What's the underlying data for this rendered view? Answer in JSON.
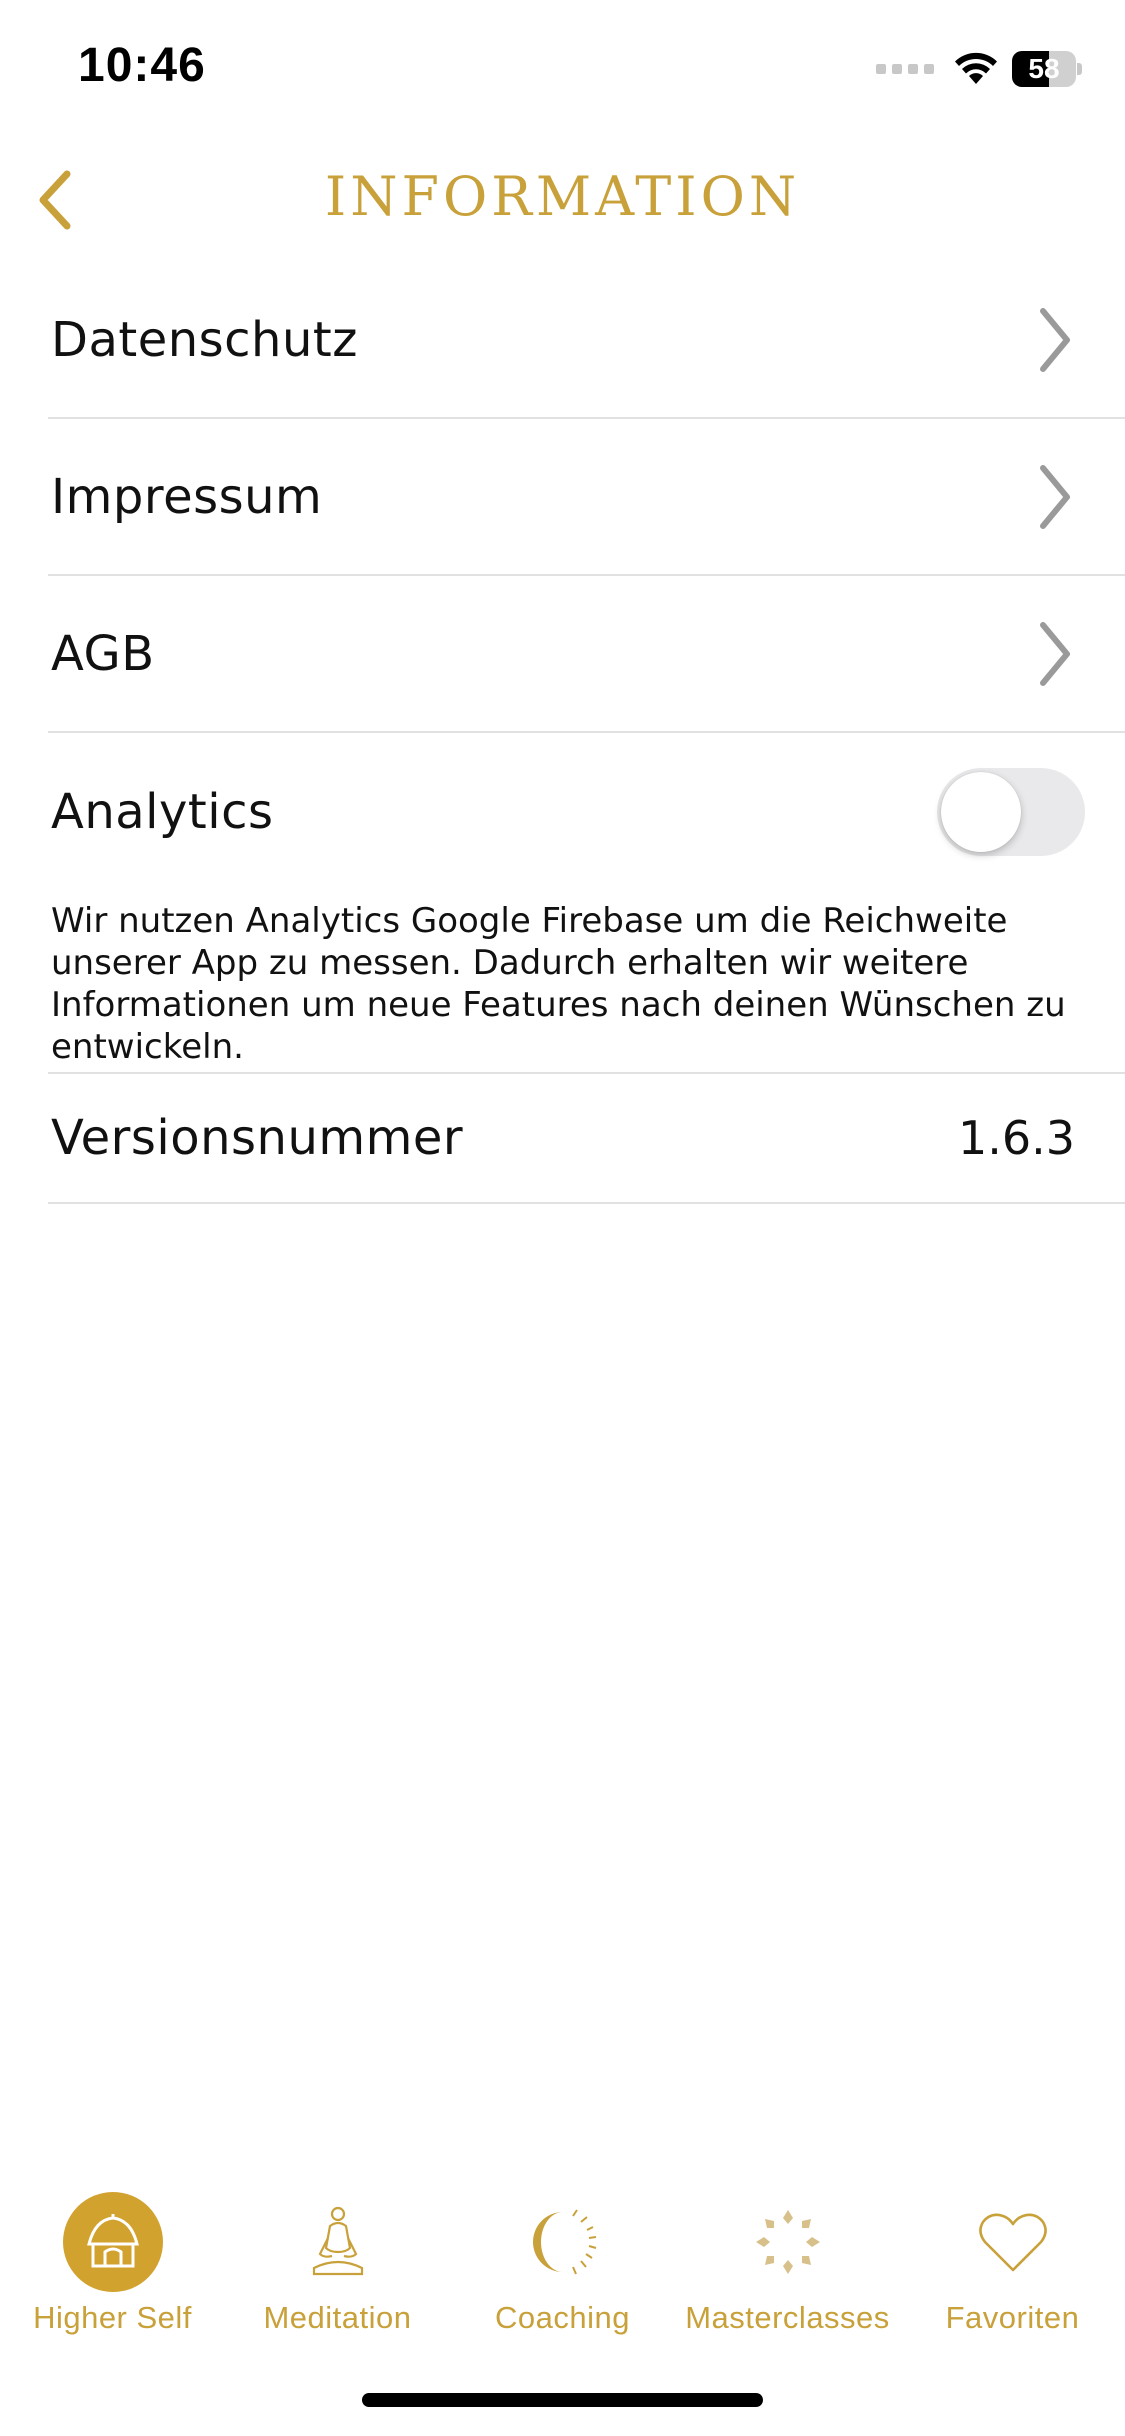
{
  "status_bar": {
    "time": "10:46",
    "battery_level": "58",
    "battery_fraction": 0.58
  },
  "nav": {
    "title": "INFORMATION",
    "back_icon": "chevron-left-icon"
  },
  "list": {
    "items": [
      {
        "label": "Datenschutz",
        "icon": "chevron-right-icon"
      },
      {
        "label": "Impressum",
        "icon": "chevron-right-icon"
      },
      {
        "label": "AGB",
        "icon": "chevron-right-icon"
      }
    ],
    "analytics": {
      "label": "Analytics",
      "enabled": false,
      "description": "Wir nutzen Analytics Google Firebase um die Reichweite unserer App zu messen. Dadurch erhalten wir weitere Informationen um neue Features nach deinen Wünschen zu entwickeln."
    },
    "version": {
      "label": "Versionsnummer",
      "value": "1.6.3"
    }
  },
  "tab_bar": {
    "tabs": [
      {
        "label": "Higher Self",
        "icon": "hut-icon",
        "active": true
      },
      {
        "label": "Meditation",
        "icon": "meditating-person-icon",
        "active": false
      },
      {
        "label": "Coaching",
        "icon": "crescent-moon-icon",
        "active": false
      },
      {
        "label": "Masterclasses",
        "icon": "flower-mandala-icon",
        "active": false
      },
      {
        "label": "Favoriten",
        "icon": "heart-icon",
        "active": false
      }
    ]
  },
  "colors": {
    "accent_gold": "#c9a13a",
    "active_tab_bg": "#d2a22f",
    "separator": "#e1e1e1",
    "chevron_gray": "#9a9a9a"
  }
}
